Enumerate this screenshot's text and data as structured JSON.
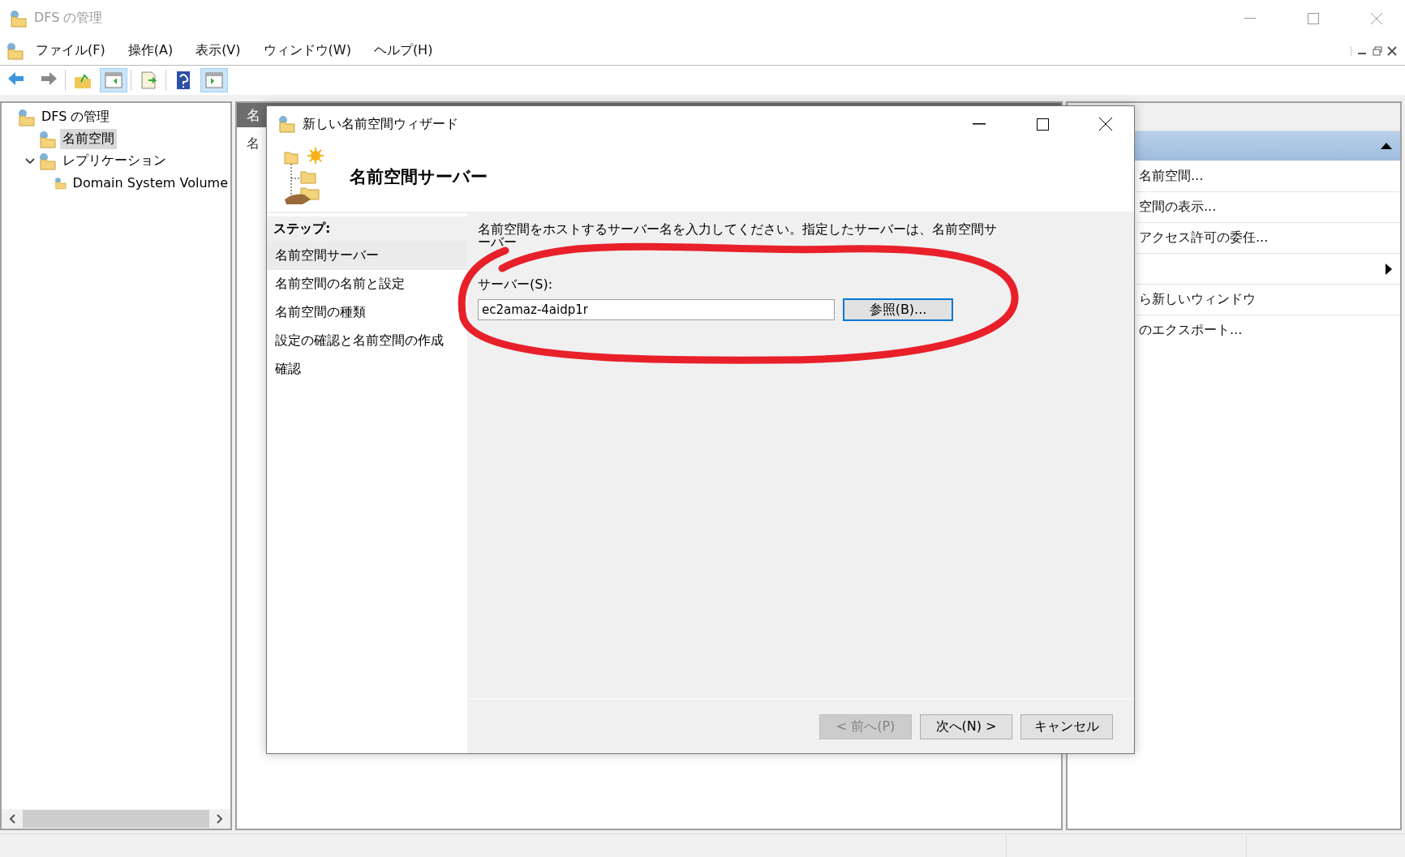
{
  "window": {
    "title": "DFS の管理"
  },
  "menu": [
    "ファイル(F)",
    "操作(A)",
    "表示(V)",
    "ウィンドウ(W)",
    "ヘルプ(H)"
  ],
  "toolbar": [
    {
      "pressed": false
    },
    {
      "pressed": false
    },
    {
      "pressed": false
    },
    {
      "pressed": true
    },
    {
      "pressed": false
    },
    {
      "pressed": false
    },
    {
      "pressed": true
    }
  ],
  "tree": [
    {
      "label": "DFS の管理",
      "selected": false,
      "children": [
        {
          "label": "名前空間",
          "selected": true
        },
        {
          "label": "レプリケーション",
          "selected": false,
          "expanded": true,
          "children": [
            {
              "label": "Domain System Volume",
              "selected": false
            }
          ]
        }
      ]
    }
  ],
  "middle_pane": {
    "header": "名",
    "text": "名"
  },
  "actions_pane": {
    "items": [
      {
        "kind": "text",
        "label": "名前空間..."
      },
      {
        "kind": "text",
        "label": "空間の表示..."
      },
      {
        "kind": "text",
        "label": "アクセス許可の委任..."
      },
      {
        "kind": "submenu"
      },
      {
        "kind": "text",
        "label": "ら新しいウィンドウ"
      },
      {
        "kind": "text",
        "label": "のエクスポート..."
      }
    ]
  },
  "wizard": {
    "title": "新しい名前空間ウィザード",
    "heading": "名前空間サーバー",
    "steps_label": "ステップ:",
    "steps": [
      {
        "label": "名前空間サーバー",
        "selected": true
      },
      {
        "label": "名前空間の名前と設定",
        "selected": false
      },
      {
        "label": "名前空間の種類",
        "selected": false
      },
      {
        "label": "設定の確認と名前空間の作成",
        "selected": false
      },
      {
        "label": "確認",
        "selected": false
      }
    ],
    "description": "名前空間をホストするサーバー名を入力してください。指定したサーバーは、名前空間サーバー",
    "server_label": "サーバー(S):",
    "server_value": "ec2amaz-4aidp1r",
    "browse_button": "参照(B)...",
    "buttons": [
      {
        "label": "< 前へ(P)",
        "disabled": true
      },
      {
        "label": "次へ(N) >",
        "disabled": false
      },
      {
        "label": "キャンセル",
        "disabled": false
      }
    ]
  }
}
